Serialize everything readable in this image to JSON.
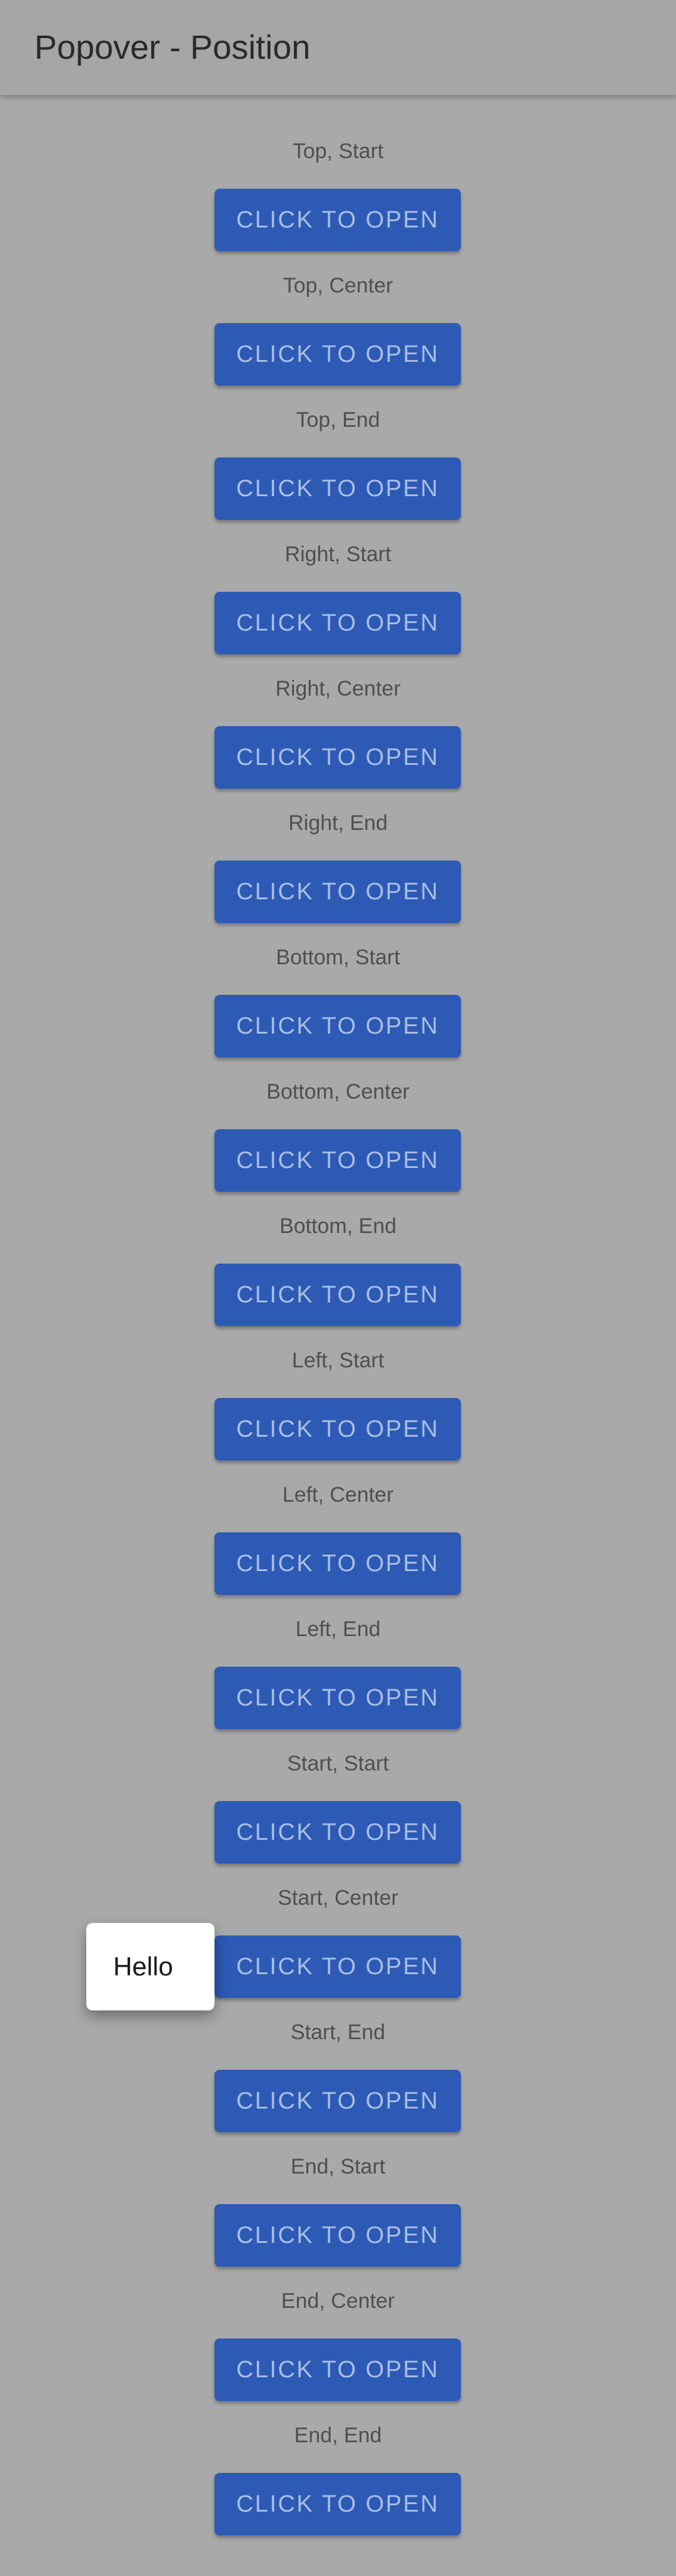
{
  "app_bar": {
    "title": "Popover - Position"
  },
  "rows": [
    {
      "label": "Top, Start",
      "button": "Click to open"
    },
    {
      "label": "Top, Center",
      "button": "Click to open"
    },
    {
      "label": "Top, End",
      "button": "Click to open"
    },
    {
      "label": "Right, Start",
      "button": "Click to open"
    },
    {
      "label": "Right, Center",
      "button": "Click to open"
    },
    {
      "label": "Right, End",
      "button": "Click to open"
    },
    {
      "label": "Bottom, Start",
      "button": "Click to open"
    },
    {
      "label": "Bottom, Center",
      "button": "Click to open"
    },
    {
      "label": "Bottom, End",
      "button": "Click to open"
    },
    {
      "label": "Left, Start",
      "button": "Click to open"
    },
    {
      "label": "Left, Center",
      "button": "Click to open"
    },
    {
      "label": "Left, End",
      "button": "Click to open"
    },
    {
      "label": "Start, Start",
      "button": "Click to open"
    },
    {
      "label": "Start, Center",
      "button": "Click to open"
    },
    {
      "label": "Start, End",
      "button": "Click to open"
    },
    {
      "label": "End, Start",
      "button": "Click to open"
    },
    {
      "label": "End, Center",
      "button": "Click to open"
    },
    {
      "label": "End, End",
      "button": "Click to open"
    }
  ],
  "popover": {
    "text": "Hello",
    "anchor_row": "Start, Center"
  },
  "colors": {
    "background": "#a9a9a9",
    "app_bar": "#a6a6a6",
    "button": "#2c5ab4",
    "button_text": "#a9bde6",
    "popover": "#ffffff"
  }
}
